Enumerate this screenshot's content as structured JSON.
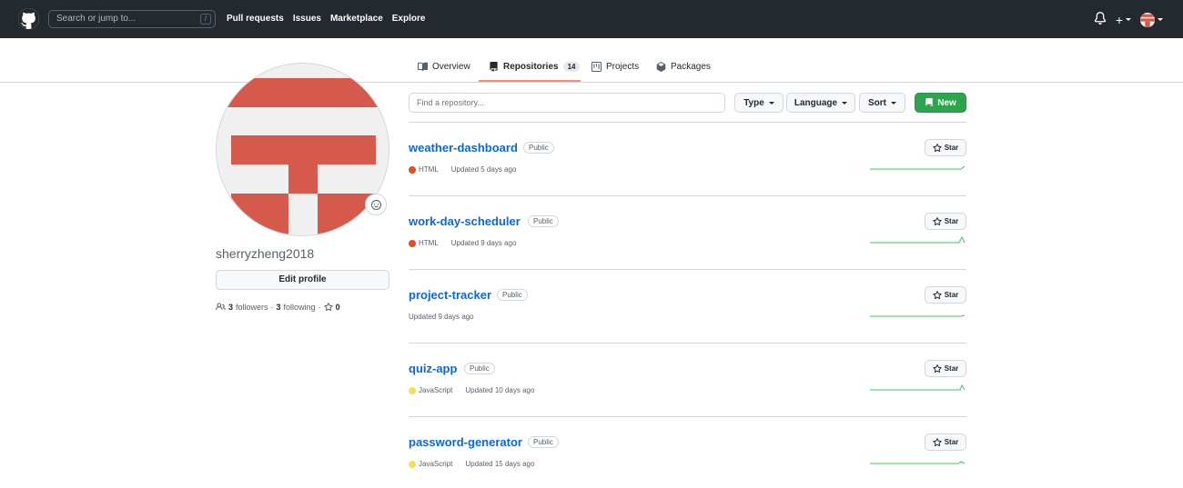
{
  "header": {
    "search_placeholder": "Search or jump to...",
    "search_shortcut": "/",
    "nav": [
      "Pull requests",
      "Issues",
      "Marketplace",
      "Explore"
    ],
    "plus_label": "+"
  },
  "tabs": [
    {
      "label": "Overview",
      "icon": "book-icon"
    },
    {
      "label": "Repositories",
      "icon": "repo-icon",
      "count": "14",
      "active": true
    },
    {
      "label": "Projects",
      "icon": "project-icon"
    },
    {
      "label": "Packages",
      "icon": "package-icon"
    }
  ],
  "profile": {
    "username": "sherryzheng2018",
    "edit_label": "Edit profile",
    "followers_count": "3",
    "followers_label": "followers",
    "separator": "·",
    "following_count": "3",
    "following_label": "following",
    "separator2": "·",
    "stars_count": "0"
  },
  "filters": {
    "find_placeholder": "Find a repository...",
    "type_label": "Type",
    "language_label": "Language",
    "sort_label": "Sort",
    "new_label": "New"
  },
  "repos": [
    {
      "name": "weather-dashboard",
      "visibility": "Public",
      "language": "HTML",
      "lang_color": "#e34c26",
      "updated": "Updated 5 days ago",
      "star_label": "Star"
    },
    {
      "name": "work-day-scheduler",
      "visibility": "Public",
      "language": "HTML",
      "lang_color": "#e34c26",
      "updated": "Updated 9 days ago",
      "star_label": "Star"
    },
    {
      "name": "project-tracker",
      "visibility": "Public",
      "language": "",
      "lang_color": "",
      "updated": "Updated 9 days ago",
      "star_label": "Star"
    },
    {
      "name": "quiz-app",
      "visibility": "Public",
      "language": "JavaScript",
      "lang_color": "#f1e05a",
      "updated": "Updated 10 days ago",
      "star_label": "Star"
    },
    {
      "name": "password-generator",
      "visibility": "Public",
      "language": "JavaScript",
      "lang_color": "#f1e05a",
      "updated": "Updated 15 days ago",
      "star_label": "Star"
    }
  ],
  "colors": {
    "header_bg": "#24292f",
    "link": "#0969da",
    "accent_underline": "#fd8c73",
    "new_button": "#2da44e",
    "avatar_red": "#d65a4c",
    "sparkline": "#2da44e"
  }
}
